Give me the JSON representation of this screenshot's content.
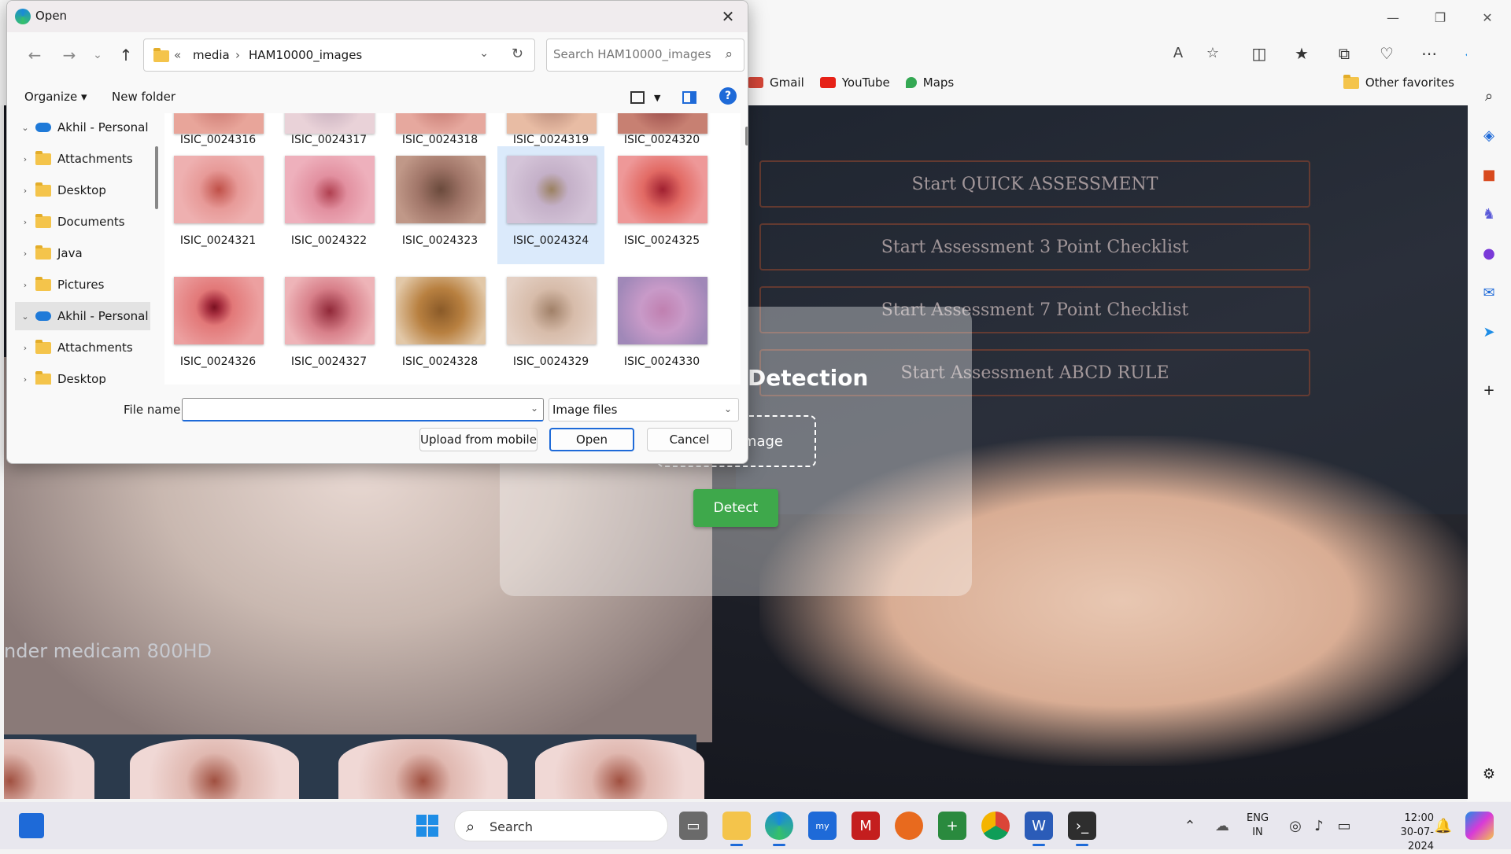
{
  "browser": {
    "favorites": [
      {
        "label": "Gmail",
        "icon": "gmail-icon",
        "color": "#d44638"
      },
      {
        "label": "YouTube",
        "icon": "youtube-icon",
        "color": "#e62117"
      },
      {
        "label": "Maps",
        "icon": "maps-icon",
        "color": "#34a853"
      }
    ],
    "other_favorites": "Other favorites"
  },
  "webpage": {
    "card_title_visible": "Detection",
    "upload_visible": "mage",
    "detect_button": "Detect",
    "bg_label": "nder medicam 800HD",
    "screen_rows": [
      "Start QUICK ASSESSMENT",
      "Start Assessment 3 Point Checklist",
      "Start Assessment 7 Point Checklist",
      "Start Assessment ABCD RULE"
    ]
  },
  "dialog": {
    "title": "Open",
    "breadcrumb": [
      "media",
      "HAM10000_images"
    ],
    "search_placeholder": "Search HAM10000_images",
    "organize": "Organize",
    "new_folder": "New folder",
    "tree": [
      {
        "label": "Akhil - Personal",
        "type": "cloud",
        "expanded": true,
        "selected": false
      },
      {
        "label": "Attachments",
        "type": "folder"
      },
      {
        "label": "Desktop",
        "type": "folder"
      },
      {
        "label": "Documents",
        "type": "folder"
      },
      {
        "label": "Java",
        "type": "folder"
      },
      {
        "label": "Pictures",
        "type": "folder"
      },
      {
        "label": "Akhil - Personal",
        "type": "cloud",
        "expanded": true,
        "selected": true
      },
      {
        "label": "Attachments",
        "type": "folder"
      },
      {
        "label": "Desktop",
        "type": "folder"
      }
    ],
    "files": [
      {
        "name": "ISIC_0024316",
        "color": "#e8a59a"
      },
      {
        "name": "ISIC_0024317",
        "color": "#e9d2d8"
      },
      {
        "name": "ISIC_0024318",
        "color": "#e6a89e"
      },
      {
        "name": "ISIC_0024319",
        "color": "#e8bca4"
      },
      {
        "name": "ISIC_0024320",
        "color": "#c78072"
      },
      {
        "name": "ISIC_0024321",
        "color": "#e79a98"
      },
      {
        "name": "ISIC_0024322",
        "color": "#e290a0"
      },
      {
        "name": "ISIC_0024323",
        "color": "#a07568"
      },
      {
        "name": "ISIC_0024324",
        "color": "#c4b0c8"
      },
      {
        "name": "ISIC_0024325",
        "color": "#e26a64"
      },
      {
        "name": "ISIC_0024326",
        "color": "#e27878"
      },
      {
        "name": "ISIC_0024327",
        "color": "#d8808a"
      },
      {
        "name": "ISIC_0024328",
        "color": "#d9a676"
      },
      {
        "name": "ISIC_0024329",
        "color": "#d7bcaa"
      },
      {
        "name": "ISIC_0024330",
        "color": "#c89ac8"
      }
    ],
    "selected_file": "ISIC_0024324",
    "file_name_label": "File name:",
    "file_name_value": "",
    "file_type": "Image files",
    "upload_mobile": "Upload from mobile",
    "open": "Open",
    "cancel": "Cancel"
  },
  "taskbar": {
    "search": "Search",
    "lang_top": "ENG",
    "lang_bottom": "IN",
    "time": "12:00",
    "date": "30-07-2024"
  }
}
